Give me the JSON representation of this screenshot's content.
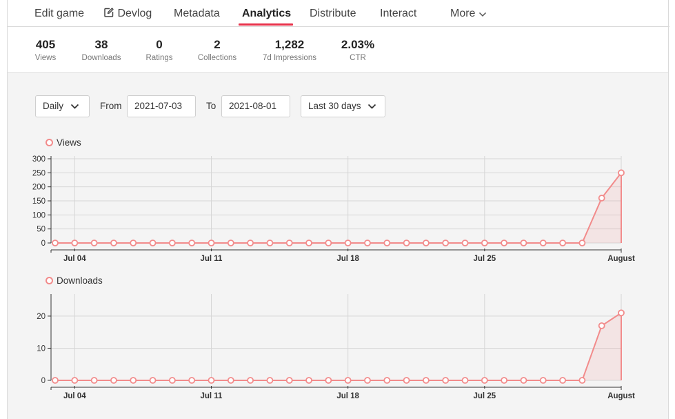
{
  "tabs": {
    "items": [
      {
        "label": "Edit game"
      },
      {
        "label": "Devlog",
        "icon": "edit-icon"
      },
      {
        "label": "Metadata"
      },
      {
        "label": "Analytics",
        "active": true
      },
      {
        "label": "Distribute"
      },
      {
        "label": "Interact"
      },
      {
        "label": "More",
        "icon": "chevron-down-icon"
      }
    ],
    "accent_color": "#e8314a"
  },
  "stats": [
    {
      "value": "405",
      "label": "Views"
    },
    {
      "value": "38",
      "label": "Downloads"
    },
    {
      "value": "0",
      "label": "Ratings"
    },
    {
      "value": "2",
      "label": "Collections"
    },
    {
      "value": "1,282",
      "label": "7d Impressions"
    },
    {
      "value": "2.03%",
      "label": "CTR"
    }
  ],
  "controls": {
    "interval": "Daily",
    "from_label": "From",
    "from_value": "2021-07-03",
    "to_label": "To",
    "to_value": "2021-08-01",
    "range": "Last 30 days"
  },
  "chart_data": [
    {
      "type": "area",
      "title": "",
      "series": [
        {
          "name": "Views",
          "color": "#f28b8b",
          "values": [
            0,
            0,
            0,
            0,
            0,
            0,
            0,
            0,
            0,
            0,
            0,
            0,
            0,
            0,
            0,
            0,
            0,
            0,
            0,
            0,
            0,
            0,
            0,
            0,
            0,
            0,
            0,
            0,
            160,
            250
          ]
        }
      ],
      "x": [
        "2021-07-03",
        "2021-07-04",
        "2021-07-05",
        "2021-07-06",
        "2021-07-07",
        "2021-07-08",
        "2021-07-09",
        "2021-07-10",
        "2021-07-11",
        "2021-07-12",
        "2021-07-13",
        "2021-07-14",
        "2021-07-15",
        "2021-07-16",
        "2021-07-17",
        "2021-07-18",
        "2021-07-19",
        "2021-07-20",
        "2021-07-21",
        "2021-07-22",
        "2021-07-23",
        "2021-07-24",
        "2021-07-25",
        "2021-07-26",
        "2021-07-27",
        "2021-07-28",
        "2021-07-29",
        "2021-07-30",
        "2021-07-31",
        "2021-08-01"
      ],
      "x_ticks": [
        {
          "x": "2021-07-04",
          "label": "Jul 04"
        },
        {
          "x": "2021-07-11",
          "label": "Jul 11"
        },
        {
          "x": "2021-07-18",
          "label": "Jul 18"
        },
        {
          "x": "2021-07-25",
          "label": "Jul 25"
        },
        {
          "x": "2021-08-01",
          "label": "August"
        }
      ],
      "y_ticks": [
        0,
        50,
        100,
        150,
        200,
        250,
        300
      ],
      "ylim": [
        0,
        300
      ],
      "grid": true,
      "legend": "top-left"
    },
    {
      "type": "area",
      "title": "",
      "series": [
        {
          "name": "Downloads",
          "color": "#f28b8b",
          "values": [
            0,
            0,
            0,
            0,
            0,
            0,
            0,
            0,
            0,
            0,
            0,
            0,
            0,
            0,
            0,
            0,
            0,
            0,
            0,
            0,
            0,
            0,
            0,
            0,
            0,
            0,
            0,
            0,
            17,
            21
          ]
        }
      ],
      "x": [
        "2021-07-03",
        "2021-07-04",
        "2021-07-05",
        "2021-07-06",
        "2021-07-07",
        "2021-07-08",
        "2021-07-09",
        "2021-07-10",
        "2021-07-11",
        "2021-07-12",
        "2021-07-13",
        "2021-07-14",
        "2021-07-15",
        "2021-07-16",
        "2021-07-17",
        "2021-07-18",
        "2021-07-19",
        "2021-07-20",
        "2021-07-21",
        "2021-07-22",
        "2021-07-23",
        "2021-07-24",
        "2021-07-25",
        "2021-07-26",
        "2021-07-27",
        "2021-07-28",
        "2021-07-29",
        "2021-07-30",
        "2021-07-31",
        "2021-08-01"
      ],
      "x_ticks": [
        {
          "x": "2021-07-04",
          "label": "Jul 04"
        },
        {
          "x": "2021-07-11",
          "label": "Jul 11"
        },
        {
          "x": "2021-07-18",
          "label": "Jul 18"
        },
        {
          "x": "2021-07-25",
          "label": "Jul 25"
        },
        {
          "x": "2021-08-01",
          "label": "August"
        }
      ],
      "y_ticks": [
        0,
        10,
        20
      ],
      "ylim": [
        0,
        26
      ],
      "grid": true,
      "legend": "top-left"
    }
  ]
}
